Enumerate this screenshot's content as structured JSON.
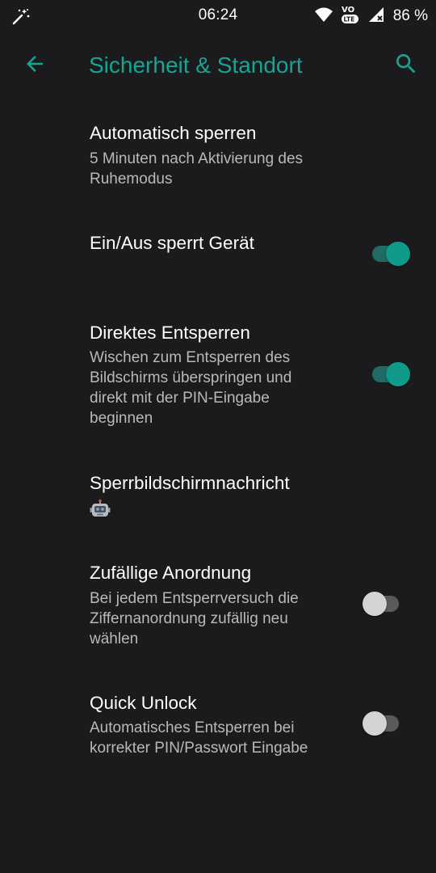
{
  "status_bar": {
    "time": "06:24",
    "battery_percent": "86 %",
    "left_icon": "magic-wand-icon",
    "icons": [
      "wifi-icon",
      "volte-icon",
      "signal-icon"
    ]
  },
  "toolbar": {
    "title": "Sicherheit & Standort",
    "back_icon": "arrow-back-icon",
    "search_icon": "search-icon",
    "accent_color": "#15a594"
  },
  "preferences": [
    {
      "title": "Automatisch sperren",
      "summary_lines": [
        "5 Minuten nach Aktivierung des",
        "Ruhemodus"
      ]
    },
    {
      "title": "Ein/Aus sperrt Gerät",
      "toggle": true
    },
    {
      "title": "Direktes Entsperren",
      "summary_lines": [
        "Wischen zum Entsperren des",
        "Bildschirms überspringen und",
        "direkt mit der PIN-Eingabe",
        "beginnen"
      ],
      "toggle": true
    },
    {
      "title": "Sperrbildschirmnachricht",
      "summary_icon": "robot-icon"
    },
    {
      "title": "Zufällige Anordnung",
      "summary_lines": [
        "Bei jedem Entsperrversuch die",
        "Ziffernanordnung zufällig neu",
        "wählen"
      ],
      "toggle": false
    },
    {
      "title": "Quick Unlock",
      "summary_lines": [
        "Automatisches Entsperren bei",
        "korrekter PIN/Passwort Eingabe"
      ],
      "toggle": false
    }
  ]
}
